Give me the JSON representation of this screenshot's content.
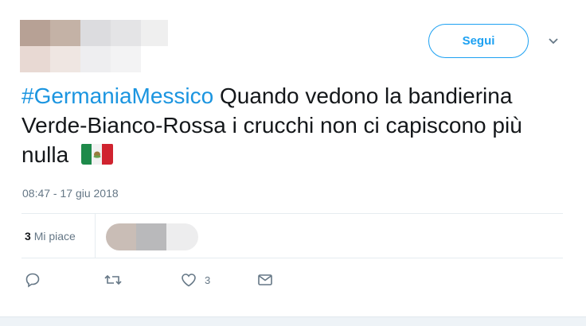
{
  "header": {
    "follow_label": "Segui"
  },
  "tweet": {
    "hashtag": "#GermaniaMessico",
    "text": "Quando vedono la bandierina Verde-Bianco-Rossa i crucchi non ci capiscono più nulla",
    "flag_emoji": "mexico-flag",
    "timestamp": "08:47 - 17 giu 2018"
  },
  "stats": {
    "likes_count": "3",
    "likes_label": "Mi piace"
  },
  "actions": {
    "reply_icon": "reply-icon",
    "retweet_icon": "retweet-icon",
    "like_icon": "heart-icon",
    "like_count": "3",
    "message_icon": "envelope-icon"
  },
  "colors": {
    "accent": "#1da1f2",
    "hashtag": "#1b95e0",
    "secondary_text": "#657786"
  }
}
